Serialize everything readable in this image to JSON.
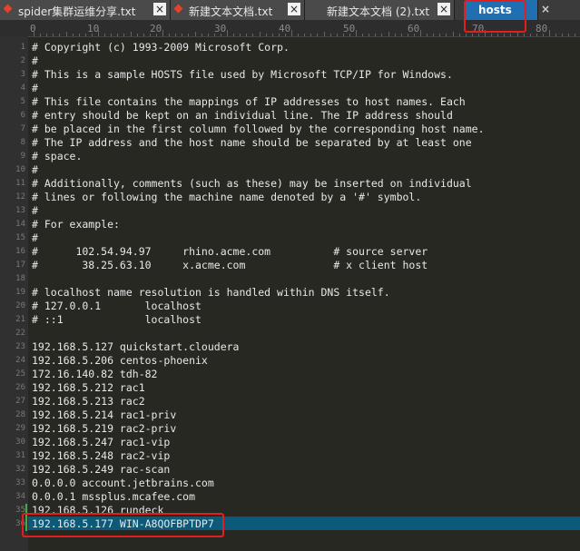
{
  "tabs": [
    {
      "label": "spider集群运维分享.txt",
      "close": "×"
    },
    {
      "label": "新建文本文档.txt",
      "close": "×"
    },
    {
      "label": "新建文本文档 (2).txt",
      "close": "×"
    },
    {
      "label": "hosts",
      "close": "×"
    }
  ],
  "ruler": [
    "0",
    "10",
    "20",
    "30",
    "40",
    "50",
    "60",
    "70",
    "80"
  ],
  "line_numbers": [
    "1",
    "2",
    "3",
    "4",
    "5",
    "6",
    "7",
    "8",
    "9",
    "10",
    "11",
    "12",
    "13",
    "14",
    "15",
    "16",
    "17",
    "18",
    "19",
    "20",
    "21",
    "22",
    "23",
    "24",
    "25",
    "26",
    "27",
    "28",
    "29",
    "30",
    "31",
    "32",
    "33",
    "34",
    "35",
    "36"
  ],
  "lines": [
    "# Copyright (c) 1993-2009 Microsoft Corp.",
    "#",
    "# This is a sample HOSTS file used by Microsoft TCP/IP for Windows.",
    "#",
    "# This file contains the mappings of IP addresses to host names. Each",
    "# entry should be kept on an individual line. The IP address should",
    "# be placed in the first column followed by the corresponding host name.",
    "# The IP address and the host name should be separated by at least one",
    "# space.",
    "#",
    "# Additionally, comments (such as these) may be inserted on individual",
    "# lines or following the machine name denoted by a '#' symbol.",
    "#",
    "# For example:",
    "#",
    "#      102.54.94.97     rhino.acme.com          # source server",
    "#       38.25.63.10     x.acme.com              # x client host",
    "",
    "# localhost name resolution is handled within DNS itself.",
    "# 127.0.0.1       localhost",
    "# ::1             localhost",
    "",
    "192.168.5.127 quickstart.cloudera",
    "192.168.5.206 centos-phoenix",
    "172.16.140.82 tdh-82",
    "192.168.5.212 rac1",
    "192.168.5.213 rac2",
    "192.168.5.214 rac1-priv",
    "192.168.5.219 rac2-priv",
    "192.168.5.247 rac1-vip",
    "192.168.5.248 rac2-vip",
    "192.168.5.249 rac-scan",
    "0.0.0.0 account.jetbrains.com",
    "0.0.0.1 mssplus.mcafee.com",
    "192.168.5.126 rundeck",
    "192.168.5.177 WIN-A8QOFBPTDP7"
  ]
}
